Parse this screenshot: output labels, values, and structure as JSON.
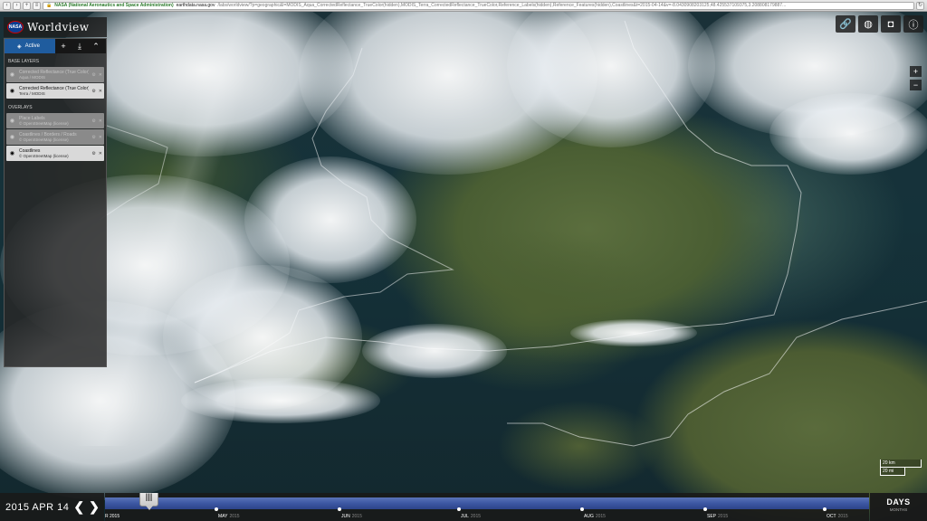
{
  "browser": {
    "site_identity": "NASA (National Aeronautics and Space Administration)",
    "domain": "earthdata.nasa.gov",
    "path": "/labs/worldview/?p=geographic&l=MODIS_Aqua_CorrectedReflectance_TrueColor(hidden),MODIS_Terra_CorrectedReflectance_TrueColor,Reference_Labels(hidden),Reference_Features(hidden),Coastlines&t=2015-04-14&v=-8.0430908203125,48.425537109375,3.208808179887..."
  },
  "brand": {
    "logo": "NASA",
    "title": "Worldview"
  },
  "panel": {
    "tab_active": "Active",
    "base_layers_title": "BASE LAYERS",
    "overlays_title": "OVERLAYS",
    "base_layers": [
      {
        "name": "Corrected Reflectance (True Color)",
        "source": "Aqua / MODIS",
        "visible": false
      },
      {
        "name": "Corrected Reflectance (True Color)",
        "source": "Terra / MODIS",
        "visible": true
      }
    ],
    "overlays": [
      {
        "name": "Place Labels",
        "source": "© OpenStreetMap (license)",
        "visible": false
      },
      {
        "name": "Coastlines / Borders / Roads",
        "source": "© OpenStreetMap (license)",
        "visible": false
      },
      {
        "name": "Coastlines",
        "source": "© OpenStreetMap (license)",
        "visible": true
      }
    ]
  },
  "scale": {
    "km": "20 km",
    "mi": "20 mi"
  },
  "timeline": {
    "date": "2015 APR 14",
    "start_fragment": "R 2015",
    "months": [
      {
        "label": "MAY",
        "year": "2015"
      },
      {
        "label": "JUN",
        "year": "2015"
      },
      {
        "label": "JUL",
        "year": "2015"
      },
      {
        "label": "AUG",
        "year": "2015"
      },
      {
        "label": "SEP",
        "year": "2015"
      },
      {
        "label": "OCT",
        "year": "2015"
      }
    ],
    "zoom_primary": "DAYS",
    "zoom_secondary": "MONTHS"
  },
  "icons": [
    "link-icon",
    "projection-globe-icon",
    "camera-icon",
    "info-icon",
    "zoom-in-icon",
    "zoom-out-icon",
    "layers-icon",
    "add-layer-icon",
    "download-icon",
    "collapse-icon",
    "eye-icon"
  ]
}
